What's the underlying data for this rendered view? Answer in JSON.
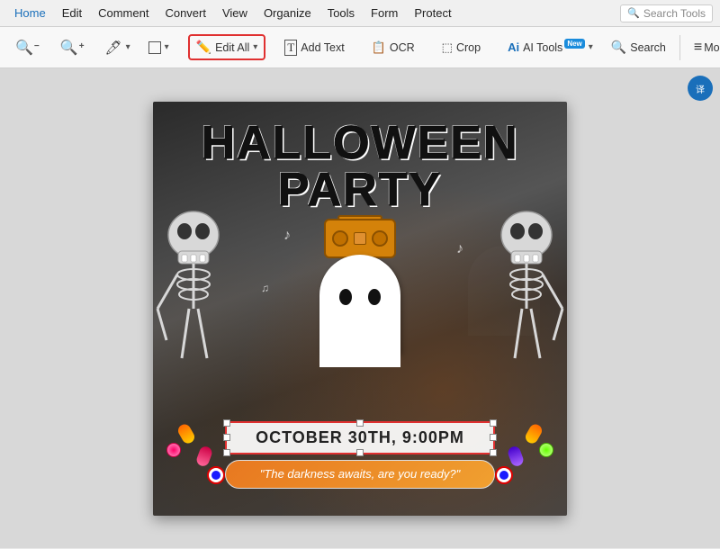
{
  "menubar": {
    "items": [
      {
        "label": "Home",
        "active": true
      },
      {
        "label": "Edit",
        "active": false
      },
      {
        "label": "Comment",
        "active": false
      },
      {
        "label": "Convert",
        "active": false
      },
      {
        "label": "View",
        "active": false
      },
      {
        "label": "Organize",
        "active": false
      },
      {
        "label": "Tools",
        "active": false
      },
      {
        "label": "Form",
        "active": false
      },
      {
        "label": "Protect",
        "active": false
      }
    ],
    "search_placeholder": "Search Tools"
  },
  "toolbar": {
    "zoom_out": "−",
    "zoom_in": "+",
    "highlight": "🖊",
    "shape_icon": "□",
    "edit_all_label": "Edit All",
    "add_text_label": "Add Text",
    "ocr_label": "OCR",
    "crop_label": "Crop",
    "ai_tools_label": "AI Tools",
    "search_label": "Search",
    "more_label": "More"
  },
  "flyer": {
    "title_line1": "HALLOWEEN",
    "title_line2": "PARTY",
    "date_text": "OCTOBER 30TH, 9:00PM",
    "quote_text": "\"The darkness awaits, are you ready?\""
  },
  "float_icon": "译"
}
